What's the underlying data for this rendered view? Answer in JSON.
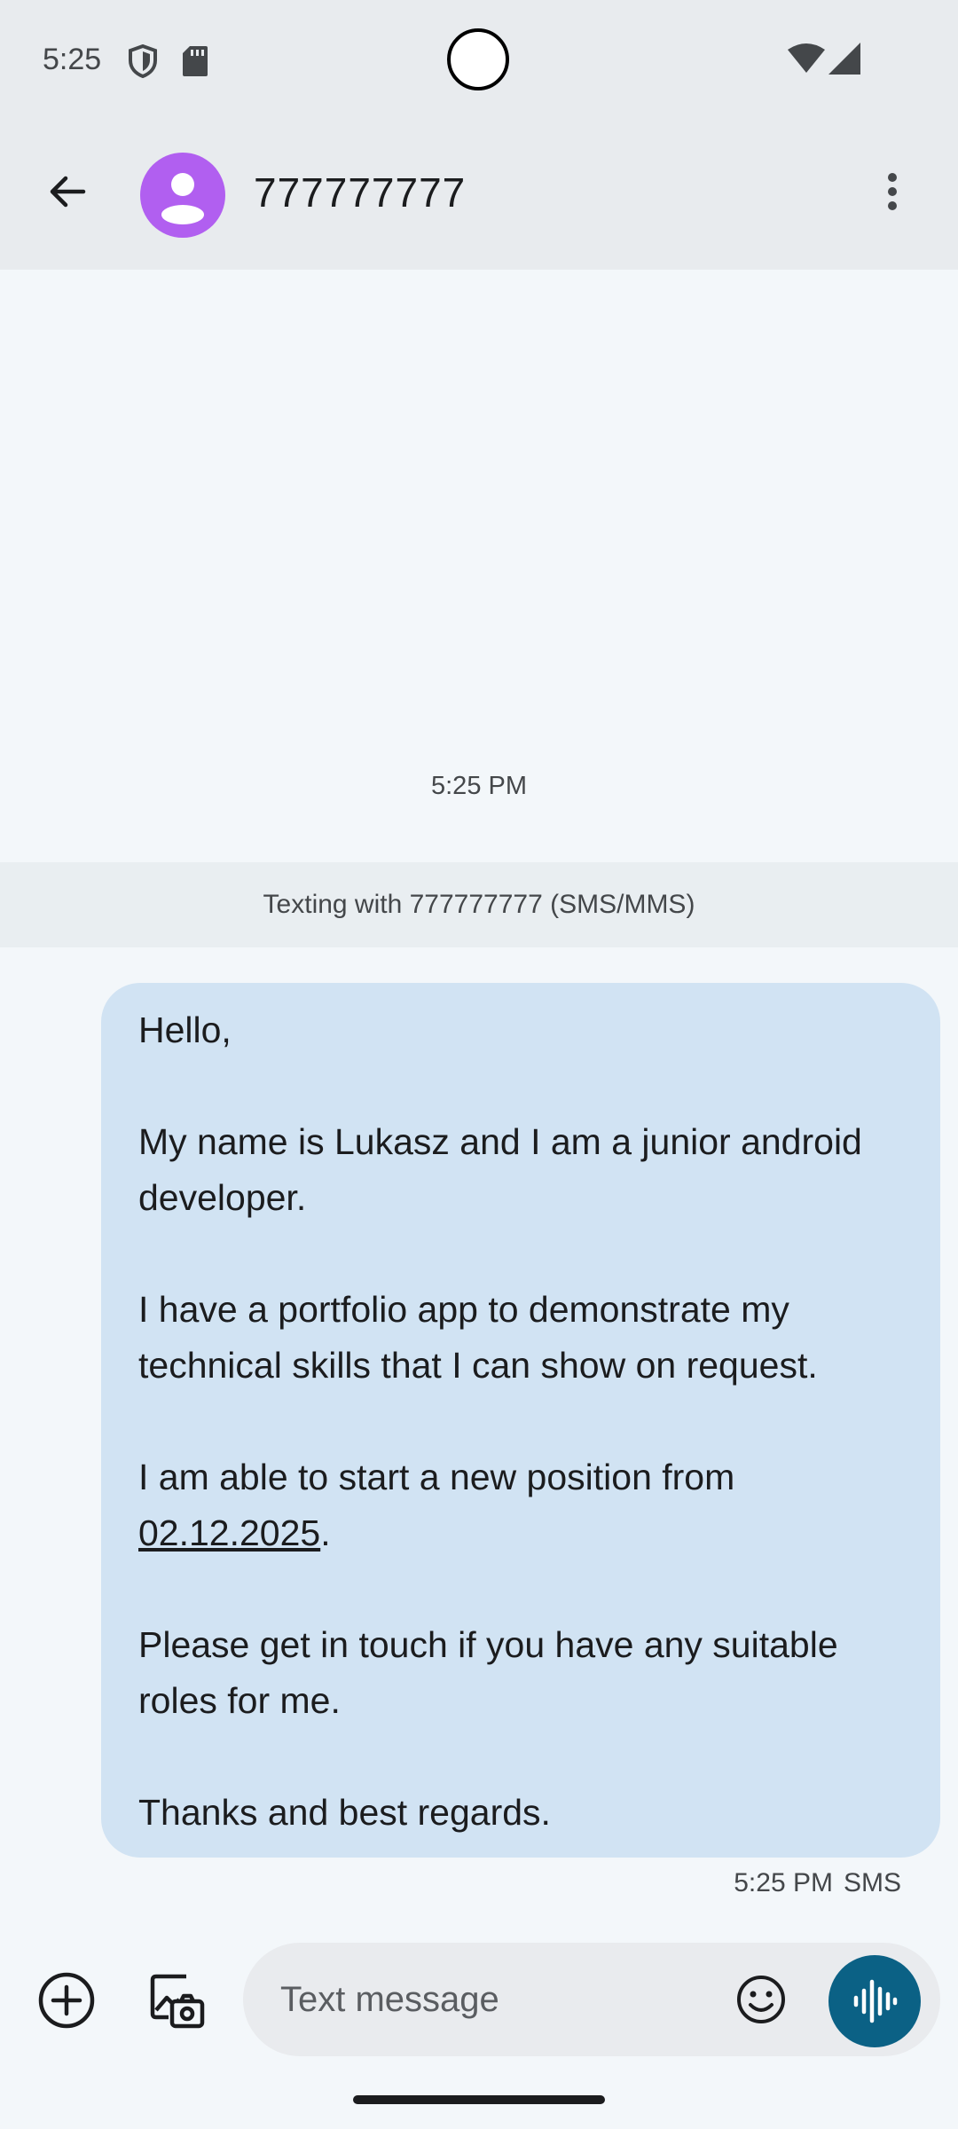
{
  "status_bar": {
    "time": "5:25",
    "icons": [
      "shield-icon",
      "sd-card-icon",
      "wifi-icon",
      "cell-signal-icon"
    ]
  },
  "app_bar": {
    "back_icon": "arrow-back-icon",
    "avatar_icon": "person-avatar-icon",
    "avatar_color": "#b15ff0",
    "title": "777777777",
    "menu_icon": "more-vert-icon"
  },
  "conversation": {
    "timestamp": "5:25 PM",
    "texting_banner": "Texting with 777777777 (SMS/MMS)",
    "message": {
      "lines": [
        "Hello,",
        "",
        "My name is Lukasz and I am a junior android",
        "developer.",
        "",
        "I have a portfolio app to demonstrate my",
        "technical skills that I can show on request.",
        "",
        "I am able to start a new position from",
        "",
        "",
        "Please get in touch if you have any suitable",
        "roles for me.",
        "",
        "Thanks and best regards."
      ],
      "date_link": "02.12.2025",
      "date_suffix": ".",
      "time": "5:25 PM",
      "type": "SMS",
      "bubble_color": "#d1e3f3"
    }
  },
  "composer": {
    "add_icon": "add-circle-icon",
    "gallery_icon": "gallery-camera-icon",
    "placeholder": "Text message",
    "emoji_icon": "emoji-icon",
    "voice_icon": "voice-waveform-icon",
    "voice_button_color": "#0b6185"
  }
}
